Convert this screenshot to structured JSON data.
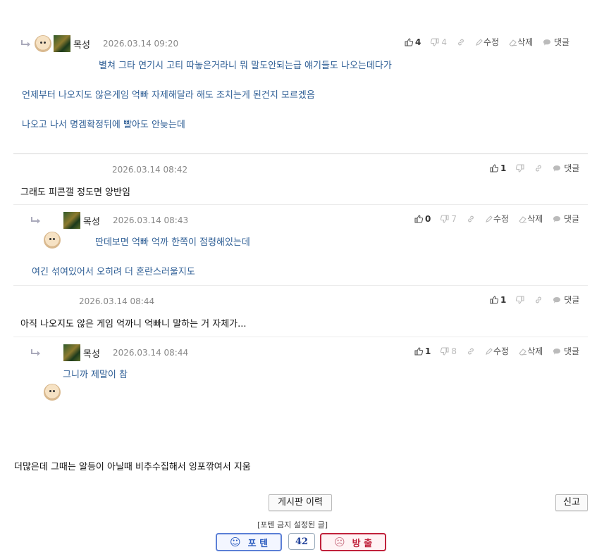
{
  "comments": [
    {
      "nick": "목성",
      "date": "2026.03.14 09:20",
      "up": "4",
      "down": "4",
      "edit": "수정",
      "delete": "삭제",
      "reply": "댓글",
      "lines": [
        "별쳐 그타 연기시 고티 따놓은거라니 뭐 말도안되는급 얘기들도 나오는데다가",
        "언제부터 나오지도 않은게임 억빠 자제해달라 해도 조치는게 된건지 모르겠음",
        "나오고 나서 명겜확정뒤에 빨아도 안늦는데"
      ]
    },
    {
      "date": "2026.03.14 08:42",
      "up": "1",
      "reply": "댓글",
      "lines": [
        "그래도 피콘갤 정도면 양반임"
      ]
    },
    {
      "nick": "목성",
      "date": "2026.03.14 08:43",
      "up": "0",
      "down": "7",
      "edit": "수정",
      "delete": "삭제",
      "reply": "댓글",
      "lines": [
        "딴데보면 억빠 억까 한쪽이 점령해있는데",
        "여긴 섞여있어서 오히려 더 혼란스러울지도"
      ]
    },
    {
      "date": "2026.03.14 08:44",
      "up": "1",
      "reply": "댓글",
      "lines": [
        "아직 나오지도 않은 게임 억까니 억빠니 말하는 거 자체가..."
      ]
    },
    {
      "nick": "목성",
      "date": "2026.03.14 08:44",
      "up": "1",
      "down": "8",
      "edit": "수정",
      "delete": "삭제",
      "reply": "댓글",
      "lines": [
        "그니까 제말이 참"
      ]
    }
  ],
  "footer": {
    "bottom_text": "더많은데 그때는 알등이 아닐때 비추수집해서 잉포깎여서 지움",
    "history_button": "게시판 이력",
    "report_button": "신고",
    "note": "[포텐 금지 설정된 글]",
    "poten_label": "포 텐",
    "count": "42",
    "bangchul_label": "방 출"
  },
  "colors": {
    "link_blue": "#2f5f96",
    "poten_blue": "#2a5bbf",
    "bangchul_red": "#c0213b"
  }
}
